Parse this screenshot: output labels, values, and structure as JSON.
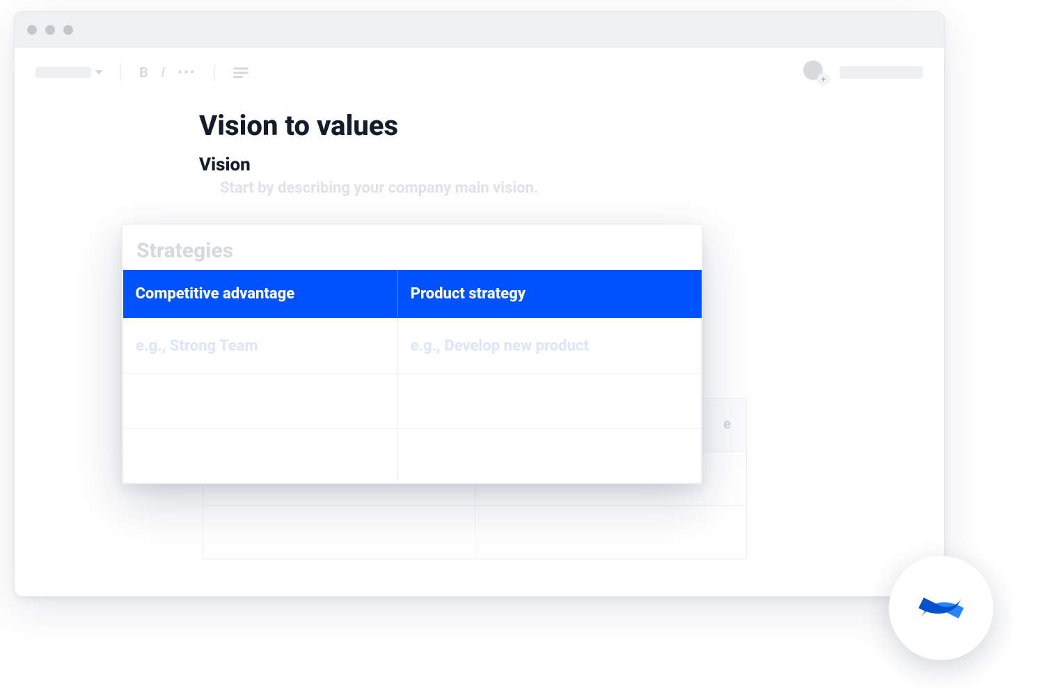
{
  "doc": {
    "title": "Vision to values",
    "section1_heading": "Vision",
    "section1_hint": "Start by describing your company main vision."
  },
  "bg_table": {
    "header_right_fragment": "e"
  },
  "card": {
    "title": "Strategies",
    "headers": [
      "Competitive advantage",
      "Product strategy"
    ],
    "row1": [
      "e.g., Strong Team",
      "e.g., Develop new product"
    ]
  },
  "toolbar": {
    "avatar_plus": "+"
  },
  "icons": {
    "bold": "B",
    "italic": "I",
    "more": "•••"
  },
  "colors": {
    "accent": "#0052ff"
  }
}
